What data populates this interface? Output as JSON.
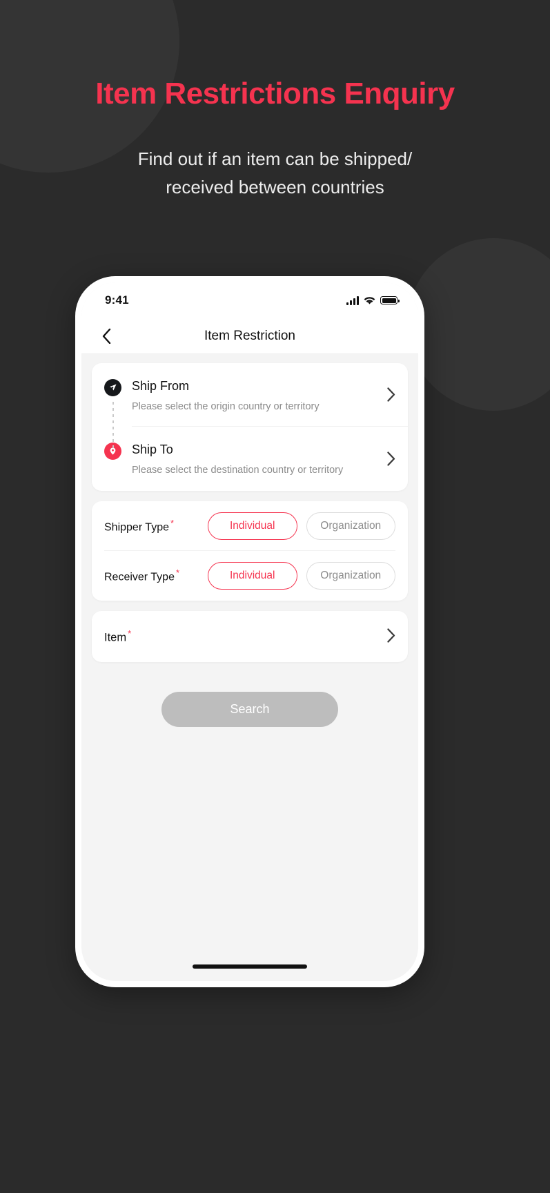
{
  "hero": {
    "title": "Item Restrictions Enquiry",
    "subtitle_line1": "Find out if an item can be shipped/",
    "subtitle_line2": "received between countries",
    "title_color": "#f5334f",
    "background_color": "#2b2b2b"
  },
  "phone": {
    "status_bar": {
      "time": "9:41",
      "signal_icon": "cellular-signal-icon",
      "wifi_icon": "wifi-icon",
      "battery_icon": "battery-full-icon"
    },
    "nav": {
      "back_icon": "chevron-left-icon",
      "title": "Item Restriction"
    },
    "route_card": {
      "ship_from": {
        "icon": "send-origin-icon",
        "icon_color": "#16181b",
        "title": "Ship From",
        "subtitle": "Please select the origin country or territory",
        "chevron": "chevron-right-icon"
      },
      "ship_to": {
        "icon": "destination-pin-icon",
        "icon_color": "#f5334f",
        "title": "Ship To",
        "subtitle": "Please select the destination country or territory",
        "chevron": "chevron-right-icon"
      }
    },
    "type_card": {
      "rows": [
        {
          "label": "Shipper Type",
          "required_marker": "*",
          "options": [
            "Individual",
            "Organization"
          ],
          "selected": "Individual"
        },
        {
          "label": "Receiver Type",
          "required_marker": "*",
          "options": [
            "Individual",
            "Organization"
          ],
          "selected": "Individual"
        }
      ]
    },
    "item_card": {
      "label": "Item",
      "required_marker": "*",
      "chevron": "chevron-right-icon"
    },
    "search_button": {
      "label": "Search",
      "state": "disabled",
      "color": "#bdbdbd"
    }
  }
}
